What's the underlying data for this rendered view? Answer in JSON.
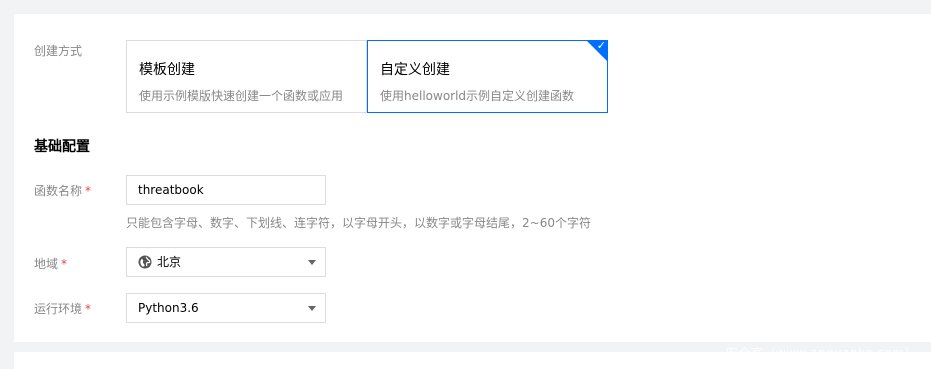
{
  "create_method": {
    "label": "创建方式",
    "options": [
      {
        "title": "模板创建",
        "desc": "使用示例模版快速创建一个函数或应用"
      },
      {
        "title": "自定义创建",
        "desc": "使用helloworld示例自定义创建函数"
      }
    ],
    "selected_index": 1
  },
  "basic_config": {
    "title": "基础配置",
    "function_name": {
      "label": "函数名称",
      "required_mark": "*",
      "value": "threatbook",
      "hint": "只能包含字母、数字、下划线、连字符，以字母开头，以数字或字母结尾，2~60个字符"
    },
    "region": {
      "label": "地域",
      "required_mark": "*",
      "value": "北京",
      "icon": "globe-icon"
    },
    "runtime": {
      "label": "运行环境",
      "required_mark": "*",
      "value": "Python3.6"
    }
  },
  "watermark": "安全客（www.anquanke.com）",
  "colors": {
    "accent": "#006eff",
    "required": "#e54545",
    "muted_text": "#888888",
    "background": "#f2f3f5"
  }
}
